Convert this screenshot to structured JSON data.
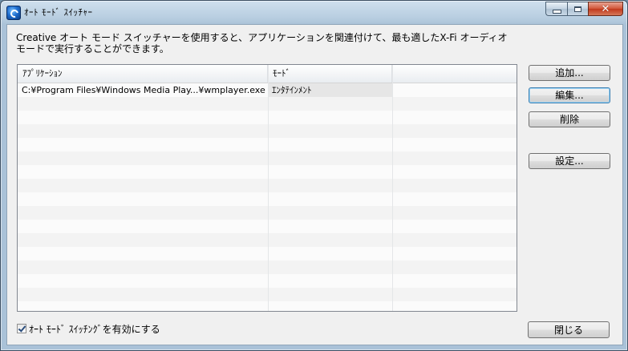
{
  "window": {
    "title": "ｵｰﾄ ﾓｰﾄﾞ ｽｲｯﾁｬｰ"
  },
  "description": "Creative オート モード スイッチャーを使用すると、アプリケーションを関連付けて、最も適したX-Fi オーディオ モードで実行することができます。",
  "list": {
    "columns": [
      "ｱﾌﾟﾘｹｰｼｮﾝ",
      "ﾓｰﾄﾞ"
    ],
    "rows": [
      {
        "application": "C:¥Program Files¥Windows Media Play...¥wmplayer.exe",
        "mode": "ｴﾝﾀﾃｲﾝﾒﾝﾄ"
      }
    ]
  },
  "buttons": {
    "add": "追加...",
    "edit": "編集...",
    "delete": "削除",
    "settings": "設定...",
    "close": "閉じる"
  },
  "checkbox": {
    "label": "ｵｰﾄ ﾓｰﾄﾞ ｽｲｯﾁﾝｸﾞを有効にする",
    "checked": true
  },
  "colors": {
    "title_bar": "#b7cde0",
    "client_bg": "#f0f0f0",
    "close_button": "#c1391c",
    "focus_border": "#3c7fb1"
  }
}
